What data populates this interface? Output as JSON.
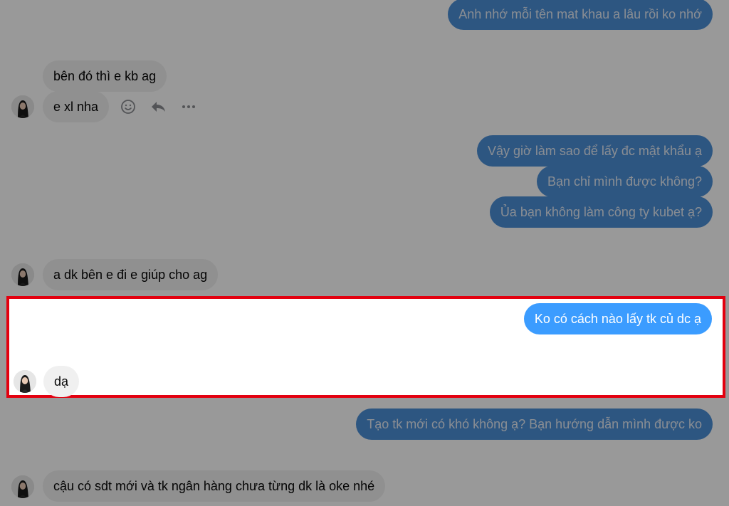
{
  "conversation": {
    "msg1": "Anh nhớ mỗi tên mat khau a lâu rồi ko nhớ",
    "msg2": "bên đó thì e kb ag",
    "msg3": "e xl nha",
    "msg4": "Vậy giờ làm sao để lấy đc mật khẩu ạ",
    "msg5": "Bạn chỉ mình được không?",
    "msg6": "Ủa bạn không làm công ty kubet ạ?",
    "msg7": "a dk bên e đi e giúp cho ag",
    "msg8": "Ko có cách nào lấy tk củ dc ạ",
    "msg9": "dạ",
    "msg10": "Tạo tk mới có khó không ạ? Bạn hướng dẫn mình được ko",
    "msg11": "cậu có sdt mới và tk ngân hàng chưa từng dk là oke nhé"
  },
  "message_actions": [
    "smiley-icon",
    "reply-icon",
    "more-icon"
  ],
  "colors": {
    "outgoing_bubble": "#0a7cff",
    "incoming_bubble": "#f0f0f0",
    "highlight_border": "#e3000f",
    "dim_overlay": "rgba(0,0,0,0.40)"
  }
}
